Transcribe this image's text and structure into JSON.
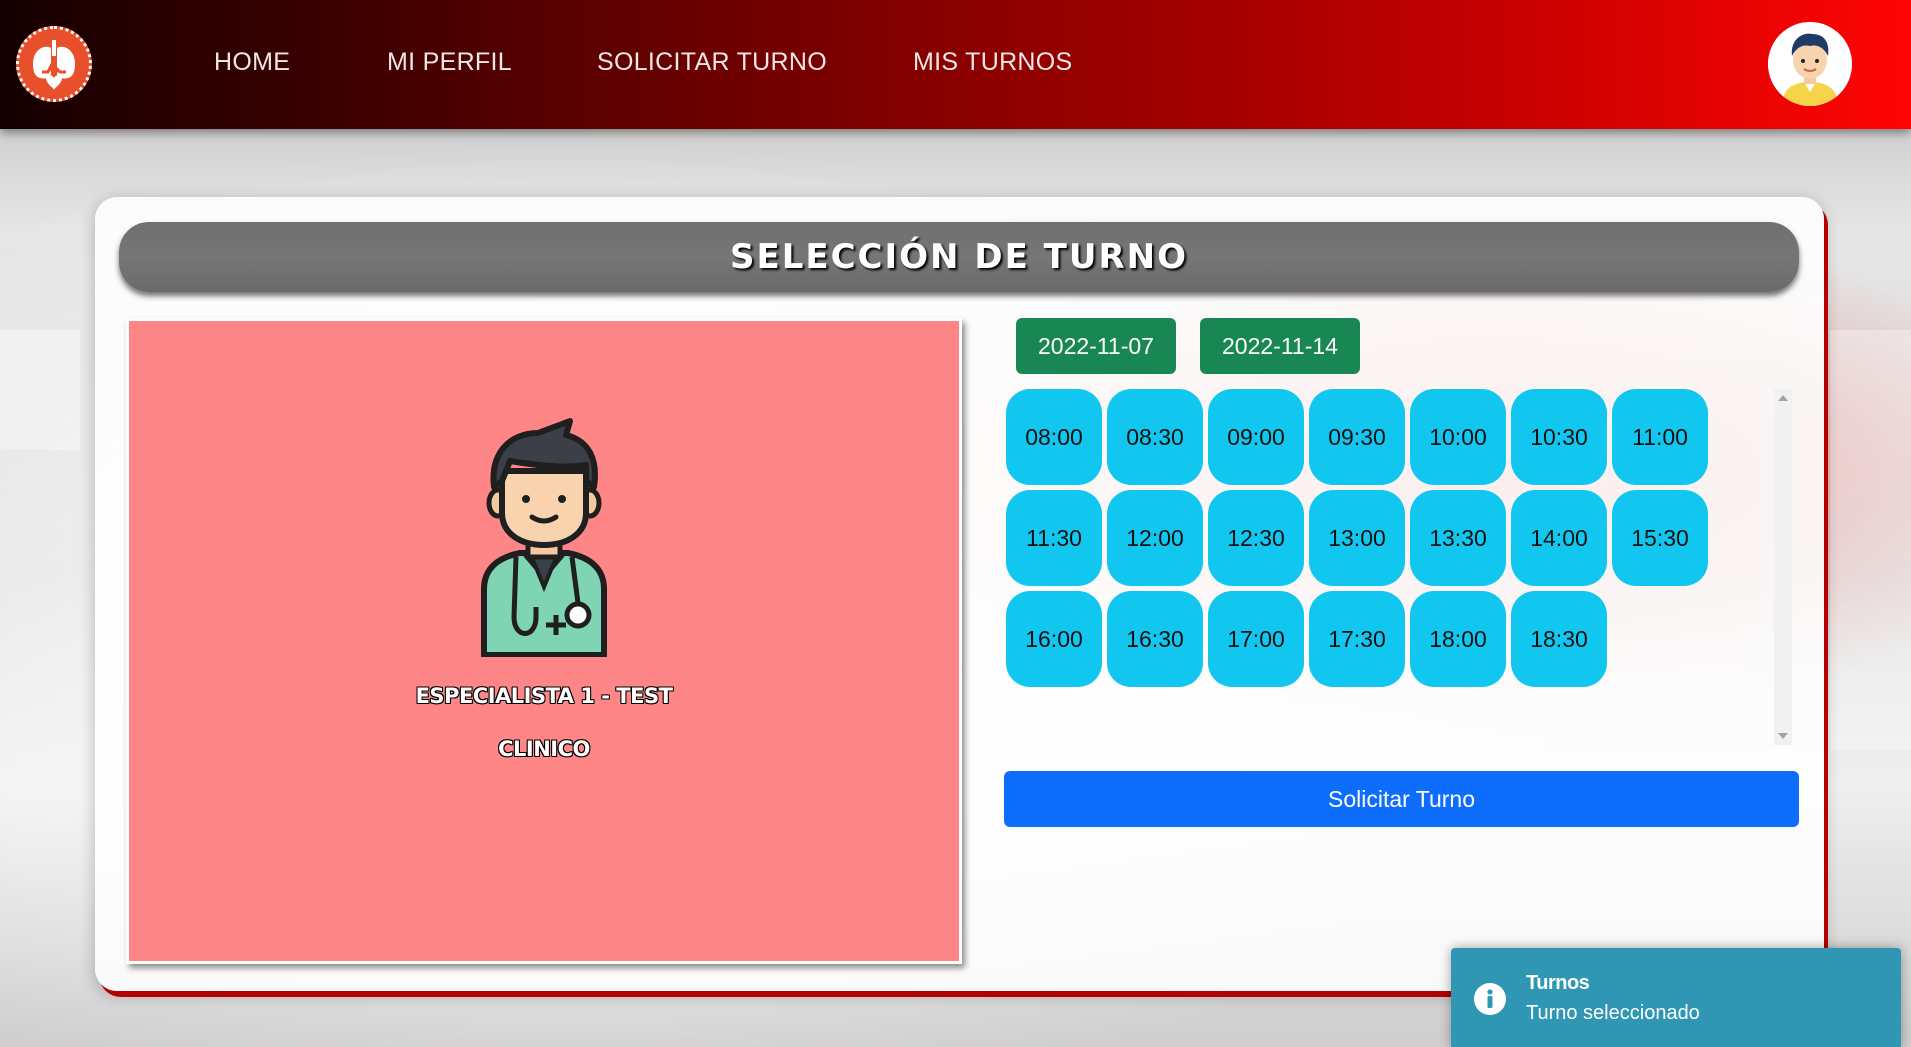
{
  "nav": {
    "logo": "lungs-heart-logo-icon",
    "links": [
      "HOME",
      "MI PERFIL",
      "SOLICITAR TURNO",
      "MIS TURNOS"
    ],
    "avatar": "user-avatar-icon"
  },
  "card": {
    "title": "SELECCIÓN DE TURNO"
  },
  "specialist": {
    "icon": "doctor-icon",
    "name": "ESPECIALISTA 1 - TEST",
    "specialty": "CLINICO",
    "panel_color": "#ff8686"
  },
  "dates": [
    "2022-11-07",
    "2022-11-14"
  ],
  "time_slots": [
    "08:00",
    "08:30",
    "09:00",
    "09:30",
    "10:00",
    "10:30",
    "11:00",
    "11:30",
    "12:00",
    "12:30",
    "13:00",
    "13:30",
    "14:00",
    "15:30",
    "16:00",
    "16:30",
    "17:00",
    "17:30",
    "18:00",
    "18:30"
  ],
  "request_button": "Solicitar Turno",
  "toast": {
    "icon": "info-icon",
    "title": "Turnos",
    "message": "Turno seleccionado"
  },
  "colors": {
    "date_button": "#198754",
    "slot": "#12c7ef",
    "primary_button": "#0d6efd",
    "toast": "#2f96b4"
  }
}
